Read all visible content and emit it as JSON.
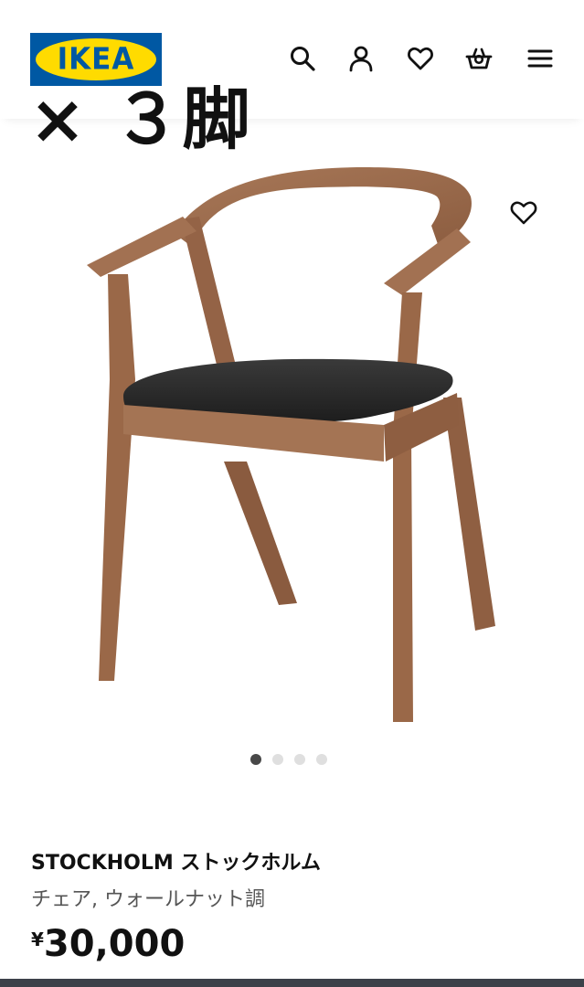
{
  "header": {
    "logo_text": "IKEA",
    "icons": [
      "search-icon",
      "account-icon",
      "heart-icon",
      "cart-icon",
      "menu-icon"
    ]
  },
  "overlay": {
    "text": "× ３脚"
  },
  "product": {
    "name": "STOCKHOLM ストックホルム",
    "description": "チェア, ウォールナット調",
    "currency": "¥",
    "price": "30,000",
    "image_count": 4,
    "active_image": 1
  },
  "colors": {
    "ikea_blue": "#0058a3",
    "ikea_yellow": "#ffdb00",
    "walnut": "#9b6b4c",
    "seat": "#2a2a2a"
  }
}
